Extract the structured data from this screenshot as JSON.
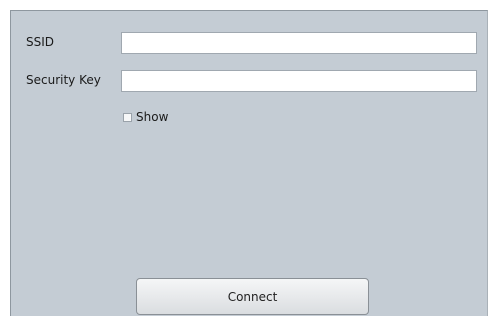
{
  "form": {
    "ssid_label": "SSID",
    "ssid_value": "",
    "security_key_label": "Security Key",
    "security_key_value": "",
    "show_label": "Show",
    "show_checked": false,
    "connect_label": "Connect"
  },
  "colors": {
    "panel_background": "#c4ccd4",
    "field_background": "#ffffff",
    "button_background": "#e8eaec"
  }
}
